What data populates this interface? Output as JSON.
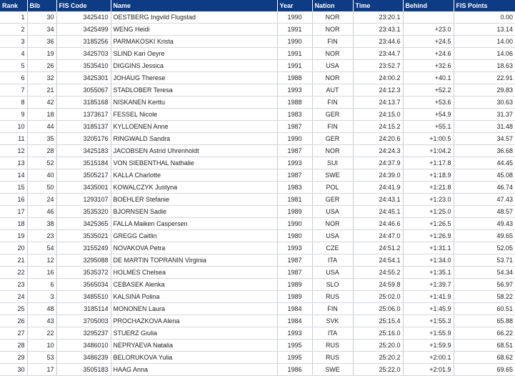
{
  "table": {
    "headers": [
      "Rank",
      "Bib",
      "FIS Code",
      "Name",
      "Year",
      "Nation",
      "Time",
      "Behind",
      "FIS Points"
    ],
    "rows": [
      [
        "1",
        "30",
        "3425410",
        "OESTBERG Ingvild Flugstad",
        "1990",
        "NOR",
        "23:20.1",
        "",
        "0.00"
      ],
      [
        "2",
        "34",
        "3425499",
        "WENG Heidi",
        "1991",
        "NOR",
        "23:43.1",
        "+23.0",
        "13.14"
      ],
      [
        "3",
        "36",
        "3185256",
        "PARMAKOSKI Krista",
        "1990",
        "FIN",
        "23:44.6",
        "+24.5",
        "14.00"
      ],
      [
        "4",
        "19",
        "3425703",
        "SLIND Kari Oeyre",
        "1991",
        "NOR",
        "23:44.7",
        "+24.6",
        "14.06"
      ],
      [
        "5",
        "26",
        "3535410",
        "DIGGINS Jessica",
        "1991",
        "USA",
        "23:52.7",
        "+32.6",
        "18.63"
      ],
      [
        "6",
        "32",
        "3425301",
        "JOHAUG Therese",
        "1988",
        "NOR",
        "24:00.2",
        "+40.1",
        "22.91"
      ],
      [
        "7",
        "21",
        "3055067",
        "STADLOBER Teresa",
        "1993",
        "AUT",
        "24:12.3",
        "+52.2",
        "29.83"
      ],
      [
        "8",
        "42",
        "3185168",
        "NISKANEN Kerttu",
        "1988",
        "FIN",
        "24:13.7",
        "+53.6",
        "30.63"
      ],
      [
        "9",
        "18",
        "1373617",
        "FESSEL Nicole",
        "1983",
        "GER",
        "24:15.0",
        "+54.9",
        "31.37"
      ],
      [
        "10",
        "44",
        "3185137",
        "KYLLOENEN Anne",
        "1987",
        "FIN",
        "24:15.2",
        "+55.1",
        "31.48"
      ],
      [
        "11",
        "35",
        "3205176",
        "RINGWALD Sandra",
        "1990",
        "GER",
        "24:20.6",
        "+1:00.5",
        "34.57"
      ],
      [
        "12",
        "28",
        "3425183",
        "JACOBSEN Astrid Uhrenholdt",
        "1987",
        "NOR",
        "24:24.3",
        "+1:04.2",
        "36.68"
      ],
      [
        "13",
        "52",
        "3515184",
        "VON SIEBENTHAL Nathalie",
        "1993",
        "SUI",
        "24:37.9",
        "+1:17.8",
        "44.45"
      ],
      [
        "14",
        "40",
        "3505217",
        "KALLA Charlotte",
        "1987",
        "SWE",
        "24:39.0",
        "+1:18.9",
        "45.08"
      ],
      [
        "15",
        "50",
        "3435001",
        "KOWALCZYK Justyna",
        "1983",
        "POL",
        "24:41.9",
        "+1:21.8",
        "46.74"
      ],
      [
        "16",
        "24",
        "1293107",
        "BOEHLER Stefanie",
        "1981",
        "GER",
        "24:43.1",
        "+1:23.0",
        "47.43"
      ],
      [
        "17",
        "46",
        "3535320",
        "BJORNSEN Sadie",
        "1989",
        "USA",
        "24:45.1",
        "+1:25.0",
        "48.57"
      ],
      [
        "18",
        "38",
        "3425365",
        "FALLA Maiken Caspersen",
        "1990",
        "NOR",
        "24:46.6",
        "+1:26.5",
        "49.43"
      ],
      [
        "19",
        "23",
        "3535021",
        "GREGG Caitlin",
        "1980",
        "USA",
        "24:47.0",
        "+1:26.9",
        "49.65"
      ],
      [
        "20",
        "54",
        "3155249",
        "NOVAKOVA Petra",
        "1993",
        "CZE",
        "24:51.2",
        "+1:31.1",
        "52.05"
      ],
      [
        "21",
        "12",
        "3295088",
        "DE MARTIN TOPRANIN Virginia",
        "1987",
        "ITA",
        "24:54.1",
        "+1:34.0",
        "53.71"
      ],
      [
        "22",
        "16",
        "3535372",
        "HOLMES Chelsea",
        "1987",
        "USA",
        "24:55.2",
        "+1:35.1",
        "54.34"
      ],
      [
        "23",
        "6",
        "3565034",
        "CEBASEK Alenka",
        "1989",
        "SLO",
        "24:59.8",
        "+1:39.7",
        "56.97"
      ],
      [
        "24",
        "3",
        "3485510",
        "KALSINA Polina",
        "1989",
        "RUS",
        "25:02.0",
        "+1:41.9",
        "58.22"
      ],
      [
        "25",
        "48",
        "3185114",
        "MONONEN Laura",
        "1984",
        "FIN",
        "25:06.0",
        "+1:45.9",
        "60.51"
      ],
      [
        "26",
        "43",
        "3705003",
        "PROCHAZKOVA Alena",
        "1984",
        "SVK",
        "25:15.4",
        "+1:55.3",
        "65.88"
      ],
      [
        "27",
        "22",
        "3295237",
        "STUERZ Giulia",
        "1993",
        "ITA",
        "25:16.0",
        "+1:55.9",
        "66.22"
      ],
      [
        "28",
        "10",
        "3486010",
        "NEPRYAEVA Natalia",
        "1995",
        "RUS",
        "25:20.0",
        "+1:59.9",
        "68.51"
      ],
      [
        "29",
        "53",
        "3486239",
        "BELORUKOVA Yulia",
        "1995",
        "RUS",
        "25:20.2",
        "+2:00.1",
        "68.62"
      ],
      [
        "30",
        "17",
        "3505183",
        "HAAG Anna",
        "1986",
        "SWE",
        "25:22.0",
        "+2:01.9",
        "69.65"
      ]
    ]
  },
  "colors": {
    "header_bg": "#0d3b84",
    "header_text": "#ffffff",
    "row_border": "#d4d7dc"
  }
}
